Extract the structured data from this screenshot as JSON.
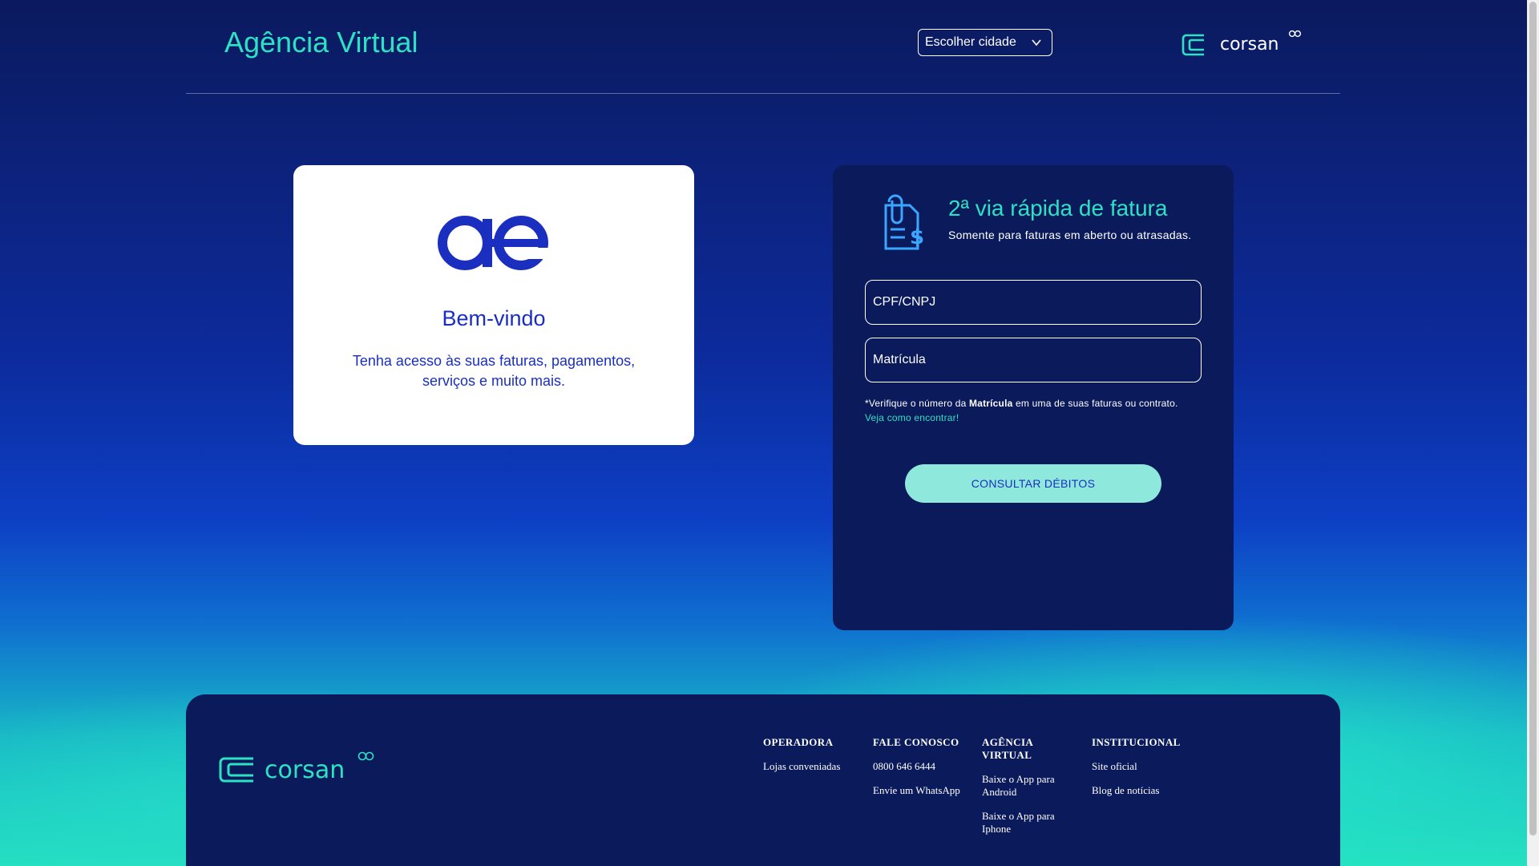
{
  "header": {
    "app_title": "Agência Virtual",
    "city_select": {
      "value": "Escolher cidade"
    },
    "brand": "corsan"
  },
  "login_card": {
    "welcome": "Bem-vindo",
    "subtitle": "Tenha acesso às suas faturas, pagamentos, serviços e muito mais."
  },
  "invoice": {
    "title": "2ª via rápida de fatura",
    "subtitle": "Somente para faturas em aberto ou atrasadas.",
    "cpf_placeholder": "CPF/CNPJ",
    "matricula_placeholder": "Matrícula",
    "note_prefix": "*Verifique o número da ",
    "note_bold": "Matrícula",
    "note_suffix": " em uma de suas faturas ou contrato.",
    "note_link": "Veja como encontrar!",
    "button": "CONSULTAR DÉBITOS"
  },
  "footer": {
    "brand": "corsan",
    "columns": [
      {
        "heading": "OPERADORA",
        "links": [
          "Lojas conveniadas"
        ]
      },
      {
        "heading": "FALE CONOSCO",
        "links": [
          "0800 646 6444",
          "Envie um WhatsApp"
        ]
      },
      {
        "heading": "AGÊNCIA VIRTUAL",
        "links": [
          "Baixe o App para Android",
          "Baixe o App para Iphone"
        ]
      },
      {
        "heading": "INSTITUCIONAL",
        "links": [
          "Site oficial",
          "Blog de notícias"
        ]
      }
    ]
  },
  "colors": {
    "accent": "#2de2c4",
    "brand_blue": "#1a2fbf",
    "dark_navy": "#0a1a5a"
  }
}
